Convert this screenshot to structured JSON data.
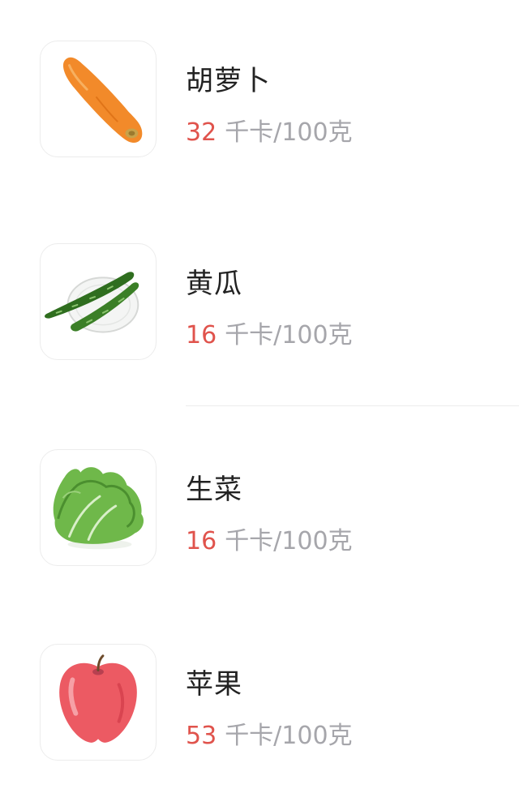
{
  "food_list": {
    "items": [
      {
        "name": "胡萝卜",
        "calories": "32",
        "unit": "千卡/100克",
        "icon": "carrot-icon",
        "color": "#f28a2a"
      },
      {
        "name": "黄瓜",
        "calories": "16",
        "unit": "千卡/100克",
        "icon": "cucumber-icon",
        "color": "#2f6e1f"
      },
      {
        "name": "生菜",
        "calories": "16",
        "unit": "千卡/100克",
        "icon": "lettuce-icon",
        "color": "#5fae3c"
      },
      {
        "name": "苹果",
        "calories": "53",
        "unit": "千卡/100克",
        "icon": "apple-icon",
        "color": "#ec5a63"
      }
    ]
  },
  "colors": {
    "calorie_value": "#e0534c",
    "unit_text": "#a6a6ab",
    "title_text": "#222222",
    "divider": "#ececec"
  }
}
